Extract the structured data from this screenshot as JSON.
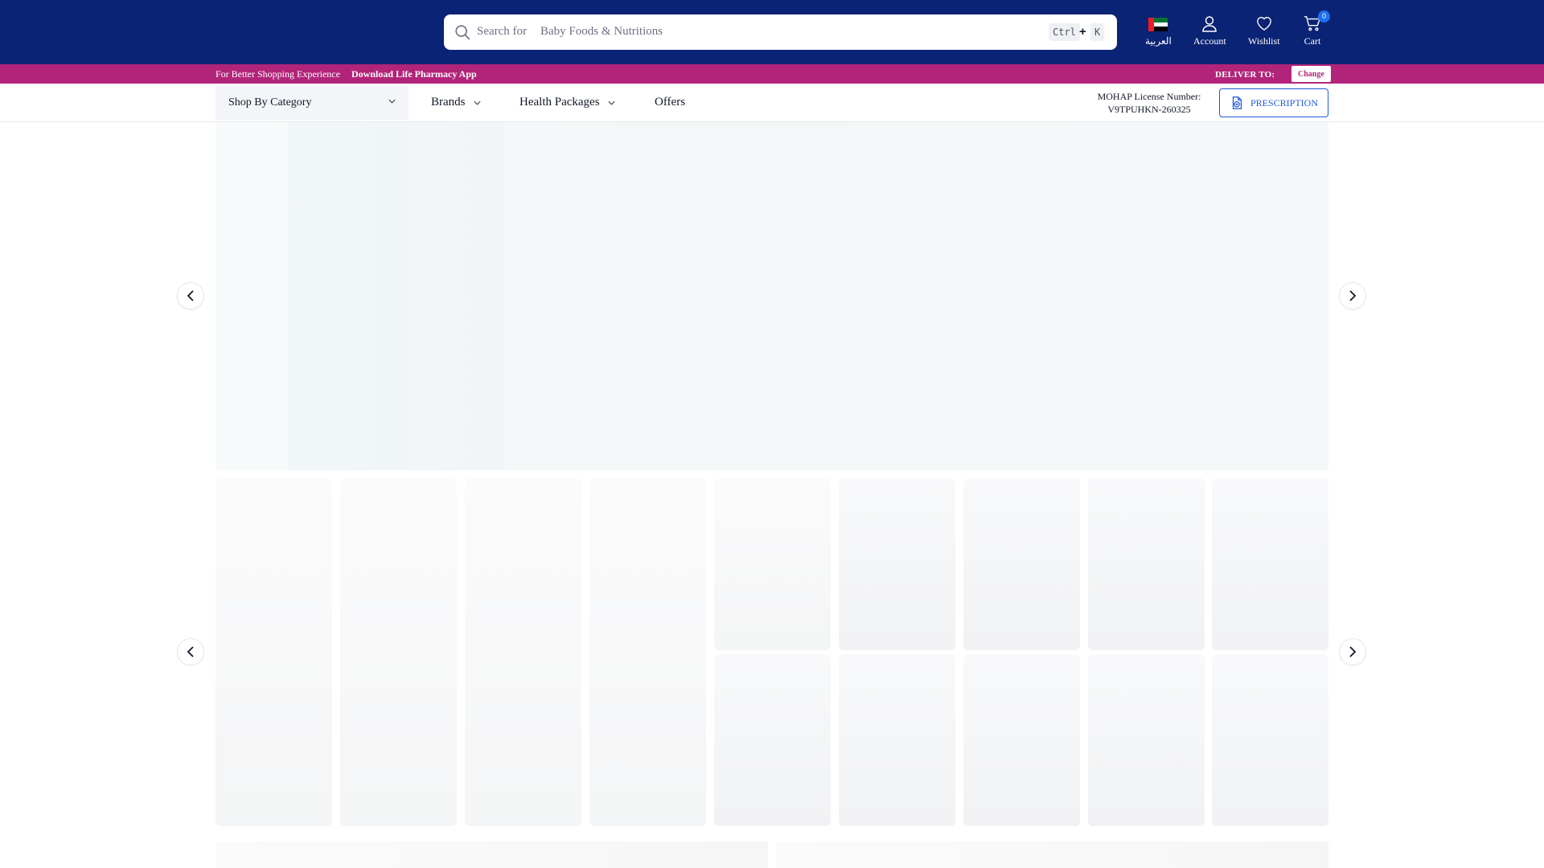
{
  "header": {
    "search": {
      "prefix": "Search for",
      "rotating_hint": "Baby Foods & Nutritions",
      "shortcut_ctrl": "Ctrl",
      "shortcut_plus": "+",
      "shortcut_key": "K"
    },
    "language_label": "العربية",
    "account_label": "Account",
    "wishlist_label": "Wishlist",
    "cart_label": "Cart",
    "cart_count": "0",
    "colors": {
      "primary": "#0b2374",
      "accent": "#1d6ff2"
    }
  },
  "promo": {
    "text": "For Better Shopping Experience",
    "app_link": "Download Life Pharmacy App",
    "deliver_label": "DELIVER TO:",
    "change_label": "Change",
    "color": "#b2247a"
  },
  "nav": {
    "category_label": "Shop By Category",
    "brands_label": "Brands",
    "health_packages_label": "Health Packages",
    "offers_label": "Offers",
    "license_line1": "MOHAP License Number:",
    "license_line2": "V9TPUHKN-260325",
    "prescription_label": "PRESCRIPTION"
  },
  "icons": {
    "search": "search-icon",
    "flag": "uae-flag-icon",
    "account": "user-icon",
    "wishlist": "heart-icon",
    "cart": "cart-icon",
    "chevron": "chevron-down-icon",
    "prescription": "prescription-upload-icon",
    "prev": "chevron-left-icon",
    "next": "chevron-right-icon"
  }
}
